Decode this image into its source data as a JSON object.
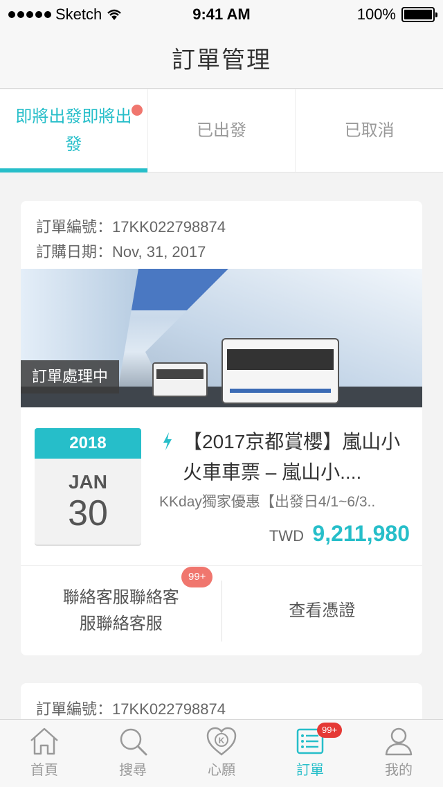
{
  "status_bar": {
    "carrier": "Sketch",
    "time": "9:41 AM",
    "battery": "100%"
  },
  "nav": {
    "title": "訂單管理"
  },
  "tabs": [
    {
      "label": "即將出發即將出發",
      "active": true,
      "has_dot": true
    },
    {
      "label": "已出發",
      "active": false
    },
    {
      "label": "已取消",
      "active": false
    }
  ],
  "orders": [
    {
      "order_no_label": "訂單編號：",
      "order_no": "17KK022798874",
      "order_date_label": "訂購日期：",
      "order_date": "Nov, 31, 2017",
      "status": "訂單處理中",
      "date": {
        "year": "2018",
        "month": "JAN",
        "day": "30"
      },
      "title": "【2017京都賞櫻】嵐山小火車車票 – 嵐山小....",
      "subtitle": "KKday獨家優惠【出發日4/1~6/3..",
      "currency": "TWD",
      "price": "9,211,980",
      "actions": {
        "contact": "聯絡客服聯絡客服聯絡客服",
        "contact_badge": "99+",
        "voucher": "查看憑證"
      }
    },
    {
      "order_no_label": "訂單編號：",
      "order_no": "17KK022798874"
    }
  ],
  "tabbar": [
    {
      "label": "首頁",
      "icon": "home-icon",
      "active": false
    },
    {
      "label": "搜尋",
      "icon": "search-icon",
      "active": false
    },
    {
      "label": "心願",
      "icon": "heart-k-icon",
      "active": false
    },
    {
      "label": "訂單",
      "icon": "order-list-icon",
      "active": true,
      "badge": "99+"
    },
    {
      "label": "我的",
      "icon": "user-icon",
      "active": false
    }
  ],
  "colors": {
    "accent": "#26bec9",
    "badge": "#f0766e",
    "background": "#f3f3f3"
  }
}
